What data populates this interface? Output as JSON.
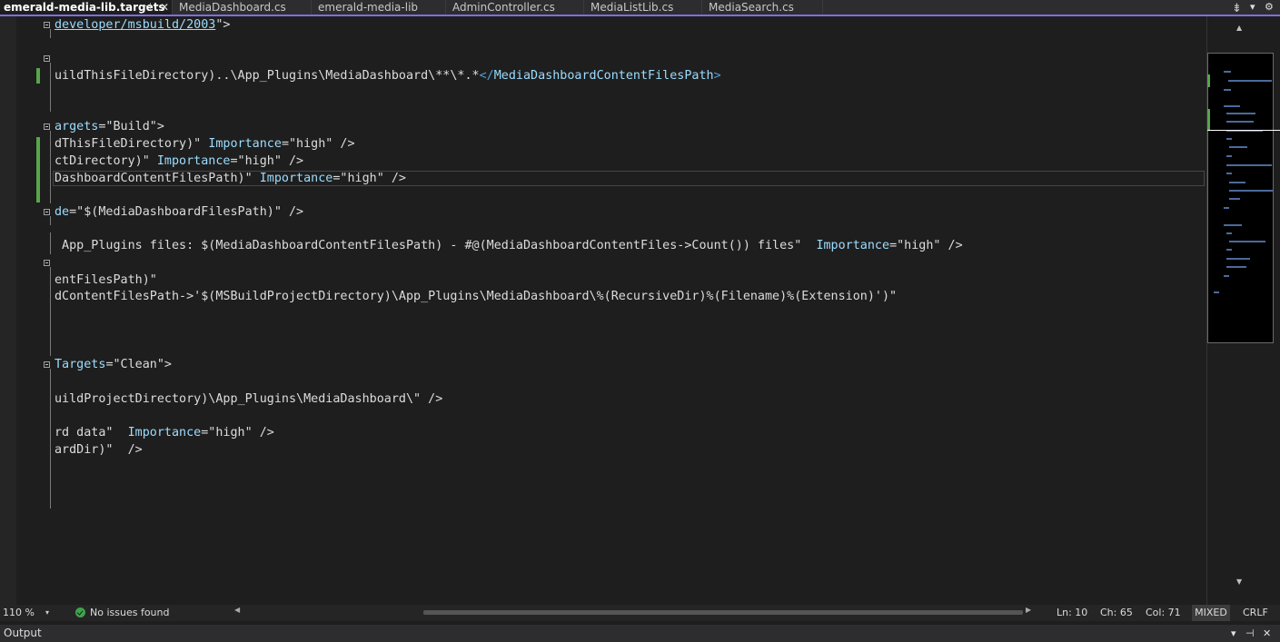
{
  "tabs": [
    {
      "label": "emerald-media-lib.targets",
      "active": true
    },
    {
      "label": "MediaDashboard.cs"
    },
    {
      "label": "emerald-media-lib"
    },
    {
      "label": "AdminController.cs"
    },
    {
      "label": "MediaListLib.cs"
    },
    {
      "label": "MediaSearch.cs"
    }
  ],
  "tab_controls": {
    "pin": "⊣",
    "close": "✕",
    "overflow": "▾",
    "settings": "⚙"
  },
  "code": {
    "l1_a": "developer/msbuild/2003",
    "l1_b": "\">",
    "l2_a": "uildThisFileDirectory)..\\App_Plugins\\MediaDashboard\\**\\*.*",
    "l2_b": "</",
    "l2_c": "MediaDashboardContentFilesPath",
    "l2_d": ">",
    "l3_a": "argets",
    "l3_b": "=\"Build\">",
    "l4_a": "dThisFileDirectory)\" ",
    "l4_b": "Importance",
    "l4_c": "=\"high\" />",
    "l5_a": "ctDirectory)\" ",
    "l5_b": "Importance",
    "l5_c": "=\"high\" />",
    "l6_a": "DashboardContentFilesPath)\" ",
    "l6_b": "Importance",
    "l6_c": "=\"high\" />",
    "l7_a": "de",
    "l7_b": "=\"$(MediaDashboardFilesPath)\" />",
    "l8_a": " App_Plugins files: $(MediaDashboardContentFilesPath) - #@(MediaDashboardContentFiles->Count()) files\"  ",
    "l8_b": "Importance",
    "l8_c": "=\"high\" />",
    "l9_a": "entFilesPath)\"",
    "l10_a": "dContentFilesPath->'$(MSBuildProjectDirectory)\\App_Plugins\\MediaDashboard\\%(RecursiveDir)%(Filename)%(Extension)')\"",
    "l11_a": "Targets",
    "l11_b": "=\"Clean\">",
    "l12_a": "uildProjectDirectory)\\App_Plugins\\MediaDashboard\\\" />",
    "l13_a": "rd data\"  ",
    "l13_b": "Importance",
    "l13_c": "=\"high\" />",
    "l14_a": "ardDir)\"  />"
  },
  "status": {
    "zoom": "110 %",
    "zoom_arrow": "▾",
    "issues": "No issues found",
    "ln": "Ln: 10",
    "ch": "Ch: 65",
    "col": "Col: 71",
    "encoding_mode": "MIXED",
    "line_ending": "CRLF"
  },
  "output_panel": {
    "title": "Output",
    "controls": [
      "▾",
      "⊣",
      "✕"
    ]
  },
  "colors": {
    "accent": "#7c6fe0",
    "attribute": "#9cdcfe",
    "tag": "#569cd6",
    "change_marker": "#57a64a"
  }
}
